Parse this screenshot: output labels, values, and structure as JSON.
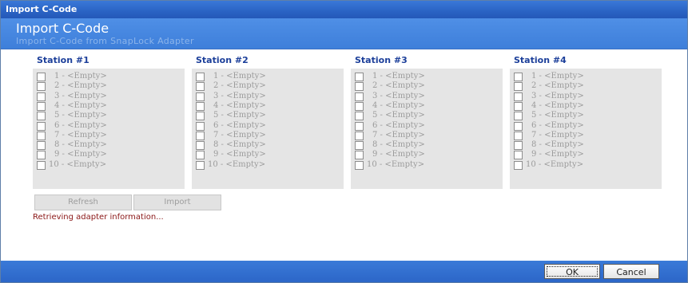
{
  "window": {
    "title": "Import C-Code"
  },
  "header": {
    "title": "Import C-Code",
    "subtitle": "Import C-Code from SnapLock Adapter"
  },
  "stations": [
    {
      "title": "Station #1",
      "slots": [
        "1 - <Empty>",
        "2 - <Empty>",
        "3 - <Empty>",
        "4 - <Empty>",
        "5 - <Empty>",
        "6 - <Empty>",
        "7 - <Empty>",
        "8 - <Empty>",
        "9 - <Empty>",
        "10 - <Empty>"
      ]
    },
    {
      "title": "Station #2",
      "slots": [
        "1 - <Empty>",
        "2 - <Empty>",
        "3 - <Empty>",
        "4 - <Empty>",
        "5 - <Empty>",
        "6 - <Empty>",
        "7 - <Empty>",
        "8 - <Empty>",
        "9 - <Empty>",
        "10 - <Empty>"
      ]
    },
    {
      "title": "Station #3",
      "slots": [
        "1 - <Empty>",
        "2 - <Empty>",
        "3 - <Empty>",
        "4 - <Empty>",
        "5 - <Empty>",
        "6 - <Empty>",
        "7 - <Empty>",
        "8 - <Empty>",
        "9 - <Empty>",
        "10 - <Empty>"
      ]
    },
    {
      "title": "Station #4",
      "slots": [
        "1 - <Empty>",
        "2 - <Empty>",
        "3 - <Empty>",
        "4 - <Empty>",
        "5 - <Empty>",
        "6 - <Empty>",
        "7 - <Empty>",
        "8 - <Empty>",
        "9 - <Empty>",
        "10 - <Empty>"
      ]
    }
  ],
  "actions": {
    "refresh_label": "Refresh",
    "import_label": "Import"
  },
  "status": {
    "text": "Retrieving adapter information..."
  },
  "footer": {
    "ok_label": "OK",
    "cancel_label": "Cancel"
  },
  "colors": {
    "titlebar": "#2a63c4",
    "header": "#4a8ae2",
    "station_title": "#1c3f9a",
    "status_text": "#8a1616",
    "slot_bg": "#e5e5e5"
  }
}
